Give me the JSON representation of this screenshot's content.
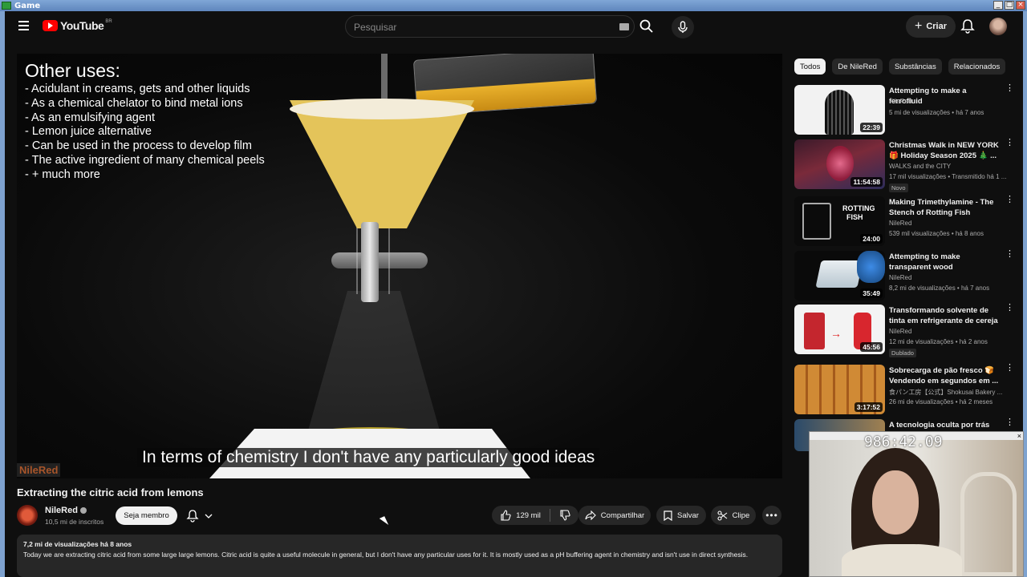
{
  "window": {
    "title": "Game"
  },
  "topbar": {
    "logo_text": "YouTube",
    "country_code": "BR",
    "search_placeholder": "Pesquisar",
    "create_label": "Criar"
  },
  "video": {
    "overlay_title": "Other uses:",
    "overlay_items": [
      "- Acidulant in creams, gets and other liquids",
      "- As a chemical chelator to bind metal ions",
      "- As an emulsifying agent",
      "- Lemon juice alternative",
      "- Can be used in the process to develop film",
      "- The active ingredient of many chemical peels",
      "- + much more"
    ],
    "caption": "In terms of chemistry I don't have any particularly good ideas",
    "watermark": "NileRed",
    "title": "Extracting the citric acid from lemons"
  },
  "channel": {
    "name": "NileRed",
    "subscribers": "10,5 mi de inscritos",
    "member_label": "Seja membro"
  },
  "actions": {
    "likes": "129 mil",
    "share": "Compartilhar",
    "save": "Salvar",
    "clip": "Clipe"
  },
  "description": {
    "meta": "7,2 mi de visualizações  há 8 anos",
    "text": "Today we are extracting citric acid from some large large lemons. Citric acid is quite a useful molecule in general, but I don't have any particular uses for it. It is mostly used as a pH buffering agent in chemistry and isn't use in direct synthesis."
  },
  "sidebar": {
    "chips": [
      "Todos",
      "De NileRed",
      "Substâncias",
      "Relacionados"
    ],
    "recommendations": [
      {
        "title": "Attempting to make a ferrofluid",
        "channel": "NileRed",
        "meta": "5 mi de visualizações • há 7 anos",
        "duration": "22:39",
        "badge": ""
      },
      {
        "title": "Christmas Walk in NEW YORK 🎁 Holiday Season 2025 🎄 ...",
        "channel": "WALKS and the CITY",
        "meta": "17 mil visualizações • Transmitido há 1 ...",
        "duration": "11:54:58",
        "badge": "Novo"
      },
      {
        "title": "Making Trimethylamine - The Stench of Rotting Fish",
        "channel": "NileRed",
        "meta": "539 mil visualizações • há 8 anos",
        "duration": "24:00",
        "badge": ""
      },
      {
        "title": "Attempting to make transparent wood",
        "channel": "NileRed",
        "meta": "8,2 mi de visualizações • há 7 anos",
        "duration": "35:49",
        "badge": ""
      },
      {
        "title": "Transformando solvente de tinta em refrigerante de cereja",
        "channel": "NileRed",
        "meta": "12 mi de visualizações • há 2 anos",
        "duration": "45:56",
        "badge": "Dublado"
      },
      {
        "title": "Sobrecarga de pão fresco 🍞 Vendendo em segundos em ...",
        "channel": "食パン工房【公式】Shokusai Bakery ...",
        "meta": "26 mi de visualizações • há 2 meses",
        "duration": "3:17:52",
        "badge": ""
      },
      {
        "title": "A tecnologia oculta por trás de ...",
        "channel": "",
        "meta": "",
        "duration": "",
        "badge": ""
      }
    ]
  },
  "webcam": {
    "timer": "986:42.09"
  },
  "colors": {
    "bg": "#0f0f0f",
    "accent": "#ff0000",
    "chip_active": "#f1f1f1"
  }
}
